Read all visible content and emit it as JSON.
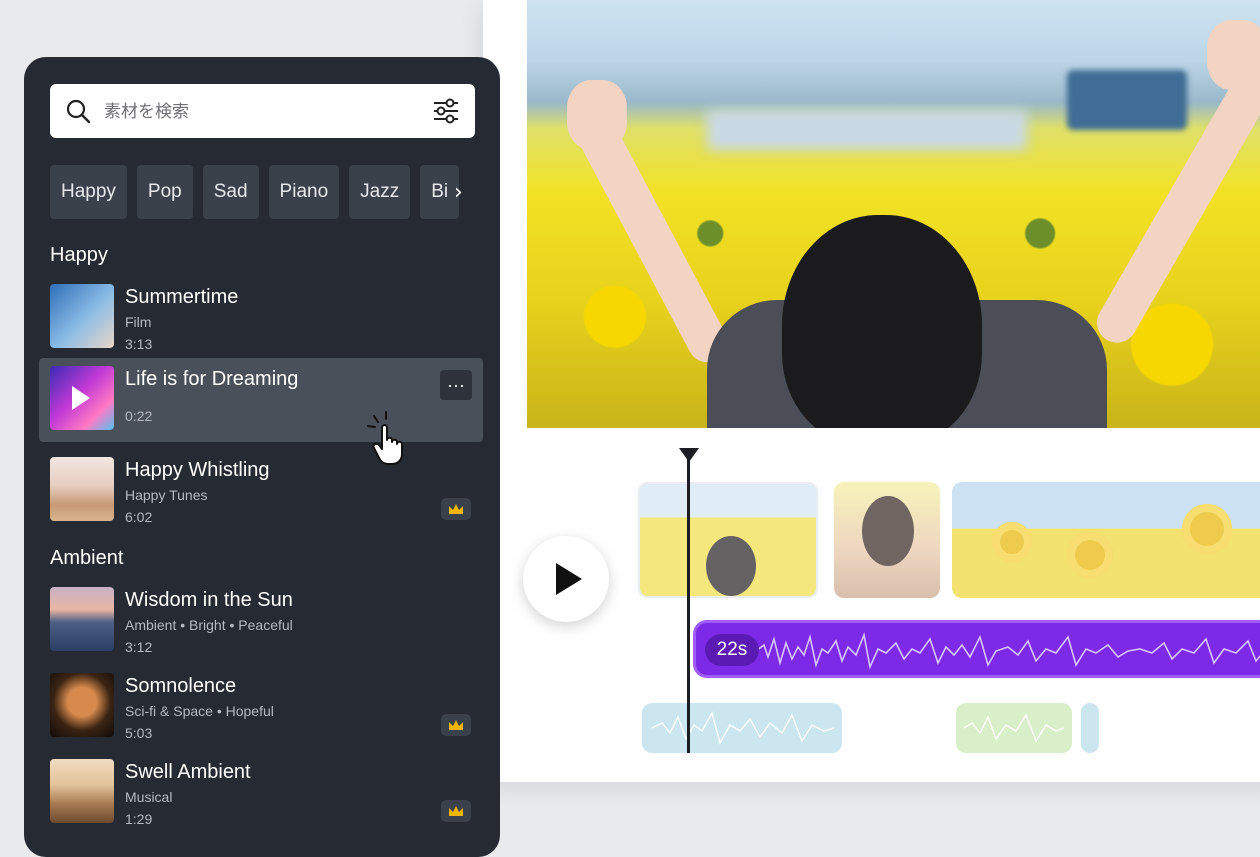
{
  "search": {
    "placeholder": "素材を検索"
  },
  "chips": [
    "Happy",
    "Pop",
    "Sad",
    "Piano",
    "Jazz",
    "Bi"
  ],
  "sections": [
    {
      "title": "Happy",
      "tracks": [
        {
          "title": "Summertime",
          "sub": "Film",
          "duration": "3:13",
          "premium": false
        },
        {
          "title": "Life is for Dreaming",
          "sub": "",
          "duration": "0:22",
          "premium": false,
          "active": true
        },
        {
          "title": "Happy Whistling",
          "sub": "Happy Tunes",
          "duration": "6:02",
          "premium": true
        }
      ]
    },
    {
      "title": "Ambient",
      "tracks": [
        {
          "title": "Wisdom in the Sun",
          "sub": "Ambient • Bright • Peaceful",
          "duration": "3:12",
          "premium": false
        },
        {
          "title": "Somnolence",
          "sub": "Sci-fi & Space • Hopeful",
          "duration": "5:03",
          "premium": true
        },
        {
          "title": "Swell Ambient",
          "sub": "Musical",
          "duration": "1:29",
          "premium": true
        }
      ]
    }
  ],
  "timeline": {
    "audio_badge": "22s"
  },
  "colors": {
    "accent": "#7d2ae8",
    "panel": "#252a33",
    "premium": "#f5b400"
  }
}
